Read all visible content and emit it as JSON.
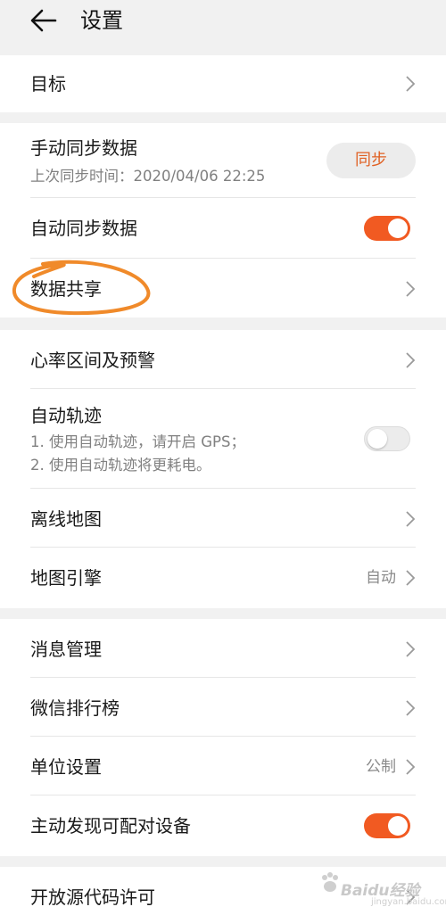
{
  "header": {
    "title": "设置"
  },
  "section1": {
    "target_label": "目标"
  },
  "section2": {
    "manual_sync": {
      "label": "手动同步数据",
      "last_sync_text": "上次同步时间：2020/04/06 22:25",
      "button_label": "同步"
    },
    "auto_sync": {
      "label": "自动同步数据",
      "enabled": true
    },
    "data_share": {
      "label": "数据共享"
    }
  },
  "section3": {
    "heart_rate": {
      "label": "心率区间及预警"
    },
    "auto_track": {
      "label": "自动轨迹",
      "desc_line1": "1. 使用自动轨迹，请开启 GPS；",
      "desc_line2": "2. 使用自动轨迹将更耗电。",
      "enabled": false
    },
    "offline_map": {
      "label": "离线地图"
    },
    "map_engine": {
      "label": "地图引擎",
      "value": "自动"
    }
  },
  "section4": {
    "message_mgmt": {
      "label": "消息管理"
    },
    "wechat_rank": {
      "label": "微信排行榜"
    },
    "unit_settings": {
      "label": "单位设置",
      "value": "公制"
    },
    "discover_devices": {
      "label": "主动发现可配对设备",
      "enabled": true
    }
  },
  "section5": {
    "open_source": {
      "label": "开放源代码许可"
    }
  },
  "watermark": {
    "text": "Baidu经验",
    "sub": "jingyan.baidu.com"
  },
  "colors": {
    "accent": "#f15a22",
    "annotation": "#f08a2a",
    "background": "#f1f1f1",
    "card": "#ffffff"
  },
  "icons": {
    "back": "arrow-left-icon",
    "chevron": "chevron-right-icon"
  }
}
